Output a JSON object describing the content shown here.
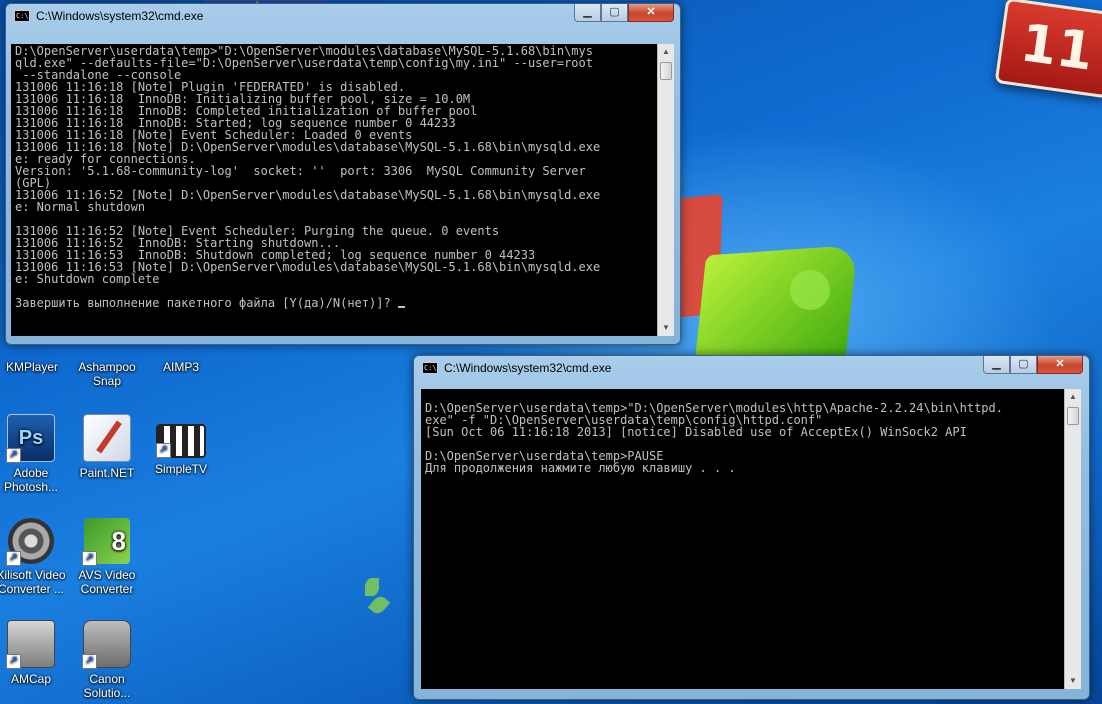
{
  "desktop": {
    "badge_text": "11",
    "icons": [
      {
        "label": "KMPlayer",
        "icon": "kmplayer-icon"
      },
      {
        "label": "Ashampoo Snap",
        "icon": "ashampoo-snap-icon"
      },
      {
        "label": "AIMP3",
        "icon": "aimp-icon"
      },
      {
        "label": "Adobe Photosh...",
        "icon": "photoshop-icon"
      },
      {
        "label": "Paint.NET",
        "icon": "paint-net-icon"
      },
      {
        "label": "SimpleTV",
        "icon": "simpletv-icon"
      },
      {
        "label": "Xilisoft Video Converter ...",
        "icon": "xilisoft-icon"
      },
      {
        "label": "AVS Video Converter",
        "icon": "avs-video-icon"
      },
      {
        "label": "AMCap",
        "icon": "amcap-icon"
      },
      {
        "label": "Canon Solutio...",
        "icon": "canon-solution-icon"
      }
    ]
  },
  "windows": [
    {
      "title": "C:\\Windows\\system32\\cmd.exe",
      "icon": "cmd-icon",
      "lines": [
        "D:\\OpenServer\\userdata\\temp>\"D:\\OpenServer\\modules\\database\\MySQL-5.1.68\\bin\\mys",
        "qld.exe\" --defaults-file=\"D:\\OpenServer\\userdata\\temp\\config\\my.ini\" --user=root",
        " --standalone --console",
        "131006 11:16:18 [Note] Plugin 'FEDERATED' is disabled.",
        "131006 11:16:18  InnoDB: Initializing buffer pool, size = 10.0M",
        "131006 11:16:18  InnoDB: Completed initialization of buffer pool",
        "131006 11:16:18  InnoDB: Started; log sequence number 0 44233",
        "131006 11:16:18 [Note] Event Scheduler: Loaded 0 events",
        "131006 11:16:18 [Note] D:\\OpenServer\\modules\\database\\MySQL-5.1.68\\bin\\mysqld.exe",
        "e: ready for connections.",
        "Version: '5.1.68-community-log'  socket: ''  port: 3306  MySQL Community Server",
        "(GPL)",
        "131006 11:16:52 [Note] D:\\OpenServer\\modules\\database\\MySQL-5.1.68\\bin\\mysqld.exe",
        "e: Normal shutdown",
        "",
        "131006 11:16:52 [Note] Event Scheduler: Purging the queue. 0 events",
        "131006 11:16:52  InnoDB: Starting shutdown...",
        "131006 11:16:53  InnoDB: Shutdown completed; log sequence number 0 44233",
        "131006 11:16:53 [Note] D:\\OpenServer\\modules\\database\\MySQL-5.1.68\\bin\\mysqld.exe",
        "e: Shutdown complete",
        "",
        "Завершить выполнение пакетного файла [Y(да)/N(нет)]? "
      ]
    },
    {
      "title": "C:\\Windows\\system32\\cmd.exe",
      "icon": "cmd-icon",
      "lines": [
        "",
        "D:\\OpenServer\\userdata\\temp>\"D:\\OpenServer\\modules\\http\\Apache-2.2.24\\bin\\httpd.",
        "exe\" -f \"D:\\OpenServer\\userdata\\temp\\config\\httpd.conf\"",
        "[Sun Oct 06 11:16:18 2013] [notice] Disabled use of AcceptEx() WinSock2 API",
        "",
        "D:\\OpenServer\\userdata\\temp>PAUSE",
        "Для продолжения нажмите любую клавишу . . ."
      ]
    }
  ]
}
